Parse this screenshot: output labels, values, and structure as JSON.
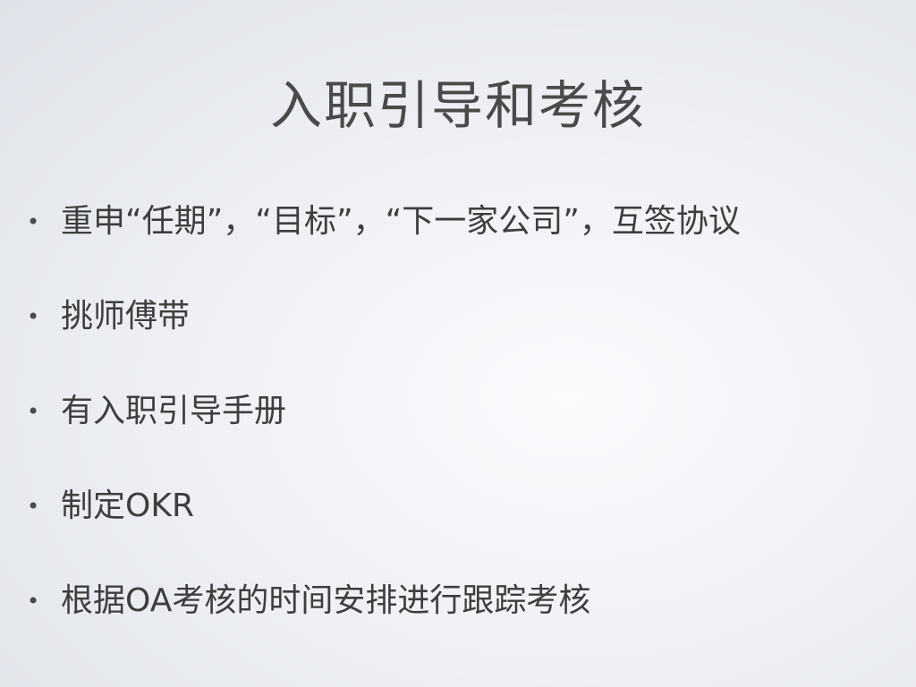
{
  "slide": {
    "title": "入职引导和考核",
    "bullets": [
      {
        "marker": "•",
        "text": "重申“任期”，“目标”，“下一家公司”，互签协议"
      },
      {
        "marker": "•",
        "text": "挑师傅带"
      },
      {
        "marker": "•",
        "text": "有入职引导手册"
      },
      {
        "marker": "•",
        "text": "制定OKR"
      },
      {
        "marker": "•",
        "text": "根据OA考核的时间安排进行跟踪考核"
      }
    ]
  }
}
